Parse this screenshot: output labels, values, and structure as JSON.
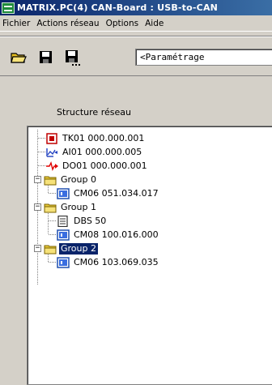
{
  "window": {
    "title": "MATRIX.PC(4)   CAN-Board : USB-to-CAN"
  },
  "menubar": [
    "Fichier",
    "Actions réseau",
    "Options",
    "Aide"
  ],
  "toolbar": {
    "buttons": [
      {
        "icon": "open-folder-icon"
      },
      {
        "icon": "save-icon"
      },
      {
        "icon": "save-as-icon"
      }
    ],
    "parameter_field": "<Paramétrage"
  },
  "section": {
    "label": "Structure réseau"
  },
  "tree": [
    {
      "label": "TK01 000.000.001",
      "icon": "tk-module-icon",
      "level": 1
    },
    {
      "label": "AI01 000.000.005",
      "icon": "analog-input-icon",
      "level": 1
    },
    {
      "label": "DO01 000.000.001",
      "icon": "digital-output-icon",
      "level": 1
    },
    {
      "label": "Group 0",
      "icon": "folder-icon",
      "level": 0,
      "expanded": true
    },
    {
      "label": "CM06 051.034.017",
      "icon": "cm-module-icon",
      "level": 1
    },
    {
      "label": "Group 1",
      "icon": "folder-icon",
      "level": 0,
      "expanded": true
    },
    {
      "label": "DBS 50",
      "icon": "dbs-device-icon",
      "level": 1
    },
    {
      "label": "CM08 100.016.000",
      "icon": "cm-module-icon",
      "level": 1
    },
    {
      "label": "Group 2",
      "icon": "folder-icon",
      "level": 0,
      "expanded": true,
      "selected": true
    },
    {
      "label": "CM06 103.069.035",
      "icon": "cm-module-icon",
      "level": 1
    }
  ]
}
